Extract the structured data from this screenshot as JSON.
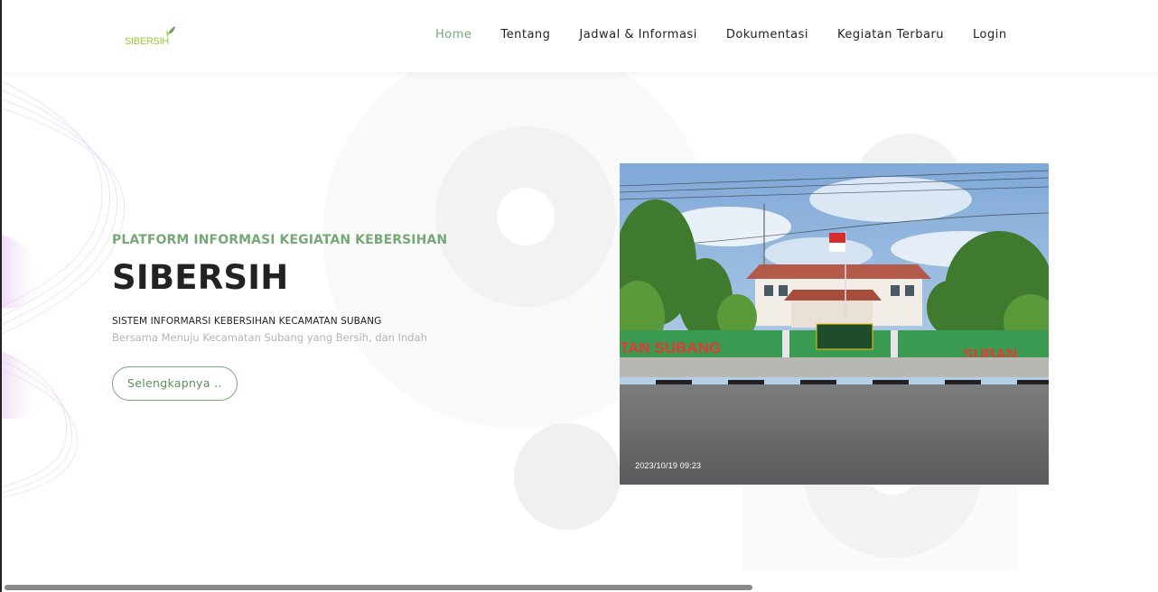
{
  "brand": {
    "logo_text": "SIBERSIH",
    "accent": "#76a877",
    "logo_color": "#9bc53d"
  },
  "nav": {
    "items": [
      {
        "label": "Home",
        "active": true
      },
      {
        "label": "Tentang",
        "active": false
      },
      {
        "label": "Jadwal & Informasi",
        "active": false
      },
      {
        "label": "Dokumentasi",
        "active": false
      },
      {
        "label": "Kegiatan Terbaru",
        "active": false
      },
      {
        "label": "Login",
        "active": false
      }
    ]
  },
  "hero": {
    "kicker": "PLATFORM INFORMASI KEGIATAN KEBERSIHAN",
    "title": "SIBERSIH",
    "subtitle": "SISTEM INFORMARSI KEBERSIHAN KECAMATAN SUBANG",
    "description": "Bersama Menuju Kecamatan Subang yang Bersih, dan Indah",
    "button_label": "Selengkapnya .."
  },
  "photo": {
    "timestamp": "2023/10/19 09:23",
    "sign_left": "TAN SUBANG",
    "sign_right": "SUBAN",
    "subject": "kantor-kecamatan-subang"
  },
  "scrollbar": {
    "horizontal_position": 0.0
  }
}
